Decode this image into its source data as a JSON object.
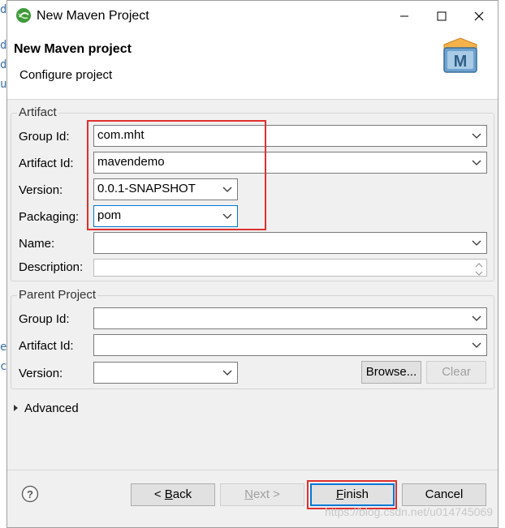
{
  "window": {
    "title": "New Maven Project",
    "app_icon": "eclipse-icon"
  },
  "header": {
    "title": "New Maven project",
    "subtitle": "Configure project",
    "logo_letter": "M"
  },
  "artifact": {
    "group_label": "Artifact",
    "group_id_label": "Group Id:",
    "group_id_value": "com.mht",
    "artifact_id_label": "Artifact Id:",
    "artifact_id_value": "mavendemo",
    "version_label": "Version:",
    "version_value": "0.0.1-SNAPSHOT",
    "packaging_label": "Packaging:",
    "packaging_value": "pom",
    "name_label": "Name:",
    "name_value": "",
    "description_label": "Description:",
    "description_value": ""
  },
  "parent": {
    "group_label": "Parent Project",
    "group_id_label": "Group Id:",
    "group_id_value": "",
    "artifact_id_label": "Artifact Id:",
    "artifact_id_value": "",
    "version_label": "Version:",
    "version_value": "",
    "browse_label": "Browse...",
    "clear_label": "Clear"
  },
  "advanced": {
    "label": "Advanced"
  },
  "buttons": {
    "back_prefix": "< ",
    "back_key": "B",
    "back_rest": "ack",
    "next_prefix": "",
    "next_key": "N",
    "next_rest": "ext >",
    "finish_key": "F",
    "finish_rest": "inish",
    "cancel_label": "Cancel"
  },
  "watermark": "https://blog.csdn.net/u014745069",
  "colors": {
    "highlight": "#e03030",
    "focus": "#0078d7",
    "dialog_bg": "#f0f0f0"
  }
}
